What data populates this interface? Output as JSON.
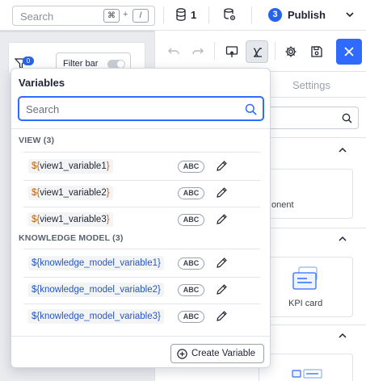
{
  "topbar": {
    "search_placeholder": "Search",
    "shortcut_key1": "⌘",
    "shortcut_plus": "+",
    "shortcut_key2": "/",
    "database_count": "1",
    "publish_count": "3",
    "publish_label": "Publish"
  },
  "canvas": {
    "filter_badge": "0",
    "filter_bar_label": "Filter bar"
  },
  "editor": {
    "settings_tab": "Settings",
    "component_label": "onent",
    "kpi_label": "KPI card"
  },
  "variables_popover": {
    "title": "Variables",
    "search_placeholder": "Search",
    "groups": [
      {
        "title": "VIEW (3)",
        "items": [
          {
            "prefix": "${",
            "name": "view1_variable1",
            "suffix": "}",
            "type": "ABC"
          },
          {
            "prefix": "${",
            "name": "view1_variable2",
            "suffix": "}",
            "type": "ABC"
          },
          {
            "prefix": "${",
            "name": "view1_variable3",
            "suffix": "}",
            "type": "ABC"
          }
        ]
      },
      {
        "title": "KNOWLEDGE MODEL (3)",
        "items": [
          {
            "prefix": "${",
            "name": "knowledge_model_variable1",
            "suffix": "}",
            "type": "ABC"
          },
          {
            "prefix": "${",
            "name": "knowledge_model_variable2",
            "suffix": "}",
            "type": "ABC"
          },
          {
            "prefix": "${",
            "name": "knowledge_model_variable3",
            "suffix": "}",
            "type": "ABC"
          }
        ]
      }
    ],
    "create_button": "Create Variable"
  },
  "colors": {
    "accent": "#2f6bff",
    "view_token": "#c2630a",
    "knowledge_token": "#2656c4"
  }
}
